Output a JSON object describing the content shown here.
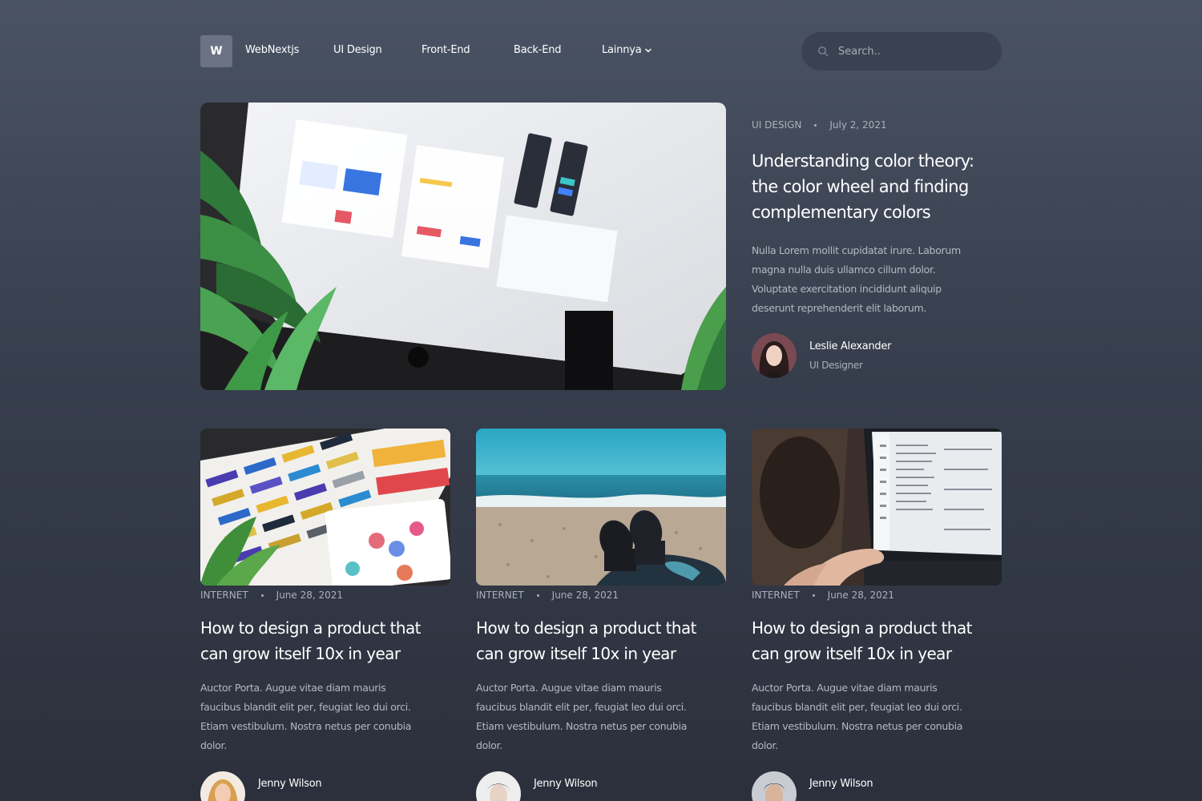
{
  "nav": {
    "logo_letter": "W",
    "logo_text": "WebNextjs",
    "links": [
      "UI Design",
      "Front-End",
      "Back-End",
      "Lainnya"
    ],
    "dropdown_icon": "chevron-down-icon"
  },
  "search": {
    "placeholder": "Search..",
    "icon": "search-icon"
  },
  "hero": {
    "category": "UI DESIGN",
    "date": "July 2, 2021",
    "title": "Understanding color theory: the color wheel and finding complementary colors",
    "description": "Nulla Lorem mollit cupidatat irure. Laborum magna nulla duis ullamco cillum dolor. Voluptate exercitation incididunt aliquip deserunt reprehenderit elit laborum.",
    "author": {
      "name": "Leslie Alexander",
      "role": "UI Designer"
    }
  },
  "cards": [
    {
      "category": "INTERNET",
      "date": "June 28, 2021",
      "title": "How to design a product that can grow itself 10x in year",
      "description": "Auctor Porta. Augue vitae diam mauris faucibus blandit elit per, feugiat leo dui orci. Etiam vestibulum. Nostra netus per conubia dolor.",
      "author": {
        "name": "Jenny Wilson"
      }
    },
    {
      "category": "INTERNET",
      "date": "June 28, 2021",
      "title": "How to design a product that can grow itself 10x in year",
      "description": "Auctor Porta. Augue vitae diam mauris faucibus blandit elit per, feugiat leo dui orci. Etiam vestibulum. Nostra netus per conubia dolor.",
      "author": {
        "name": "Jenny Wilson"
      }
    },
    {
      "category": "INTERNET",
      "date": "June 28, 2021",
      "title": "How to design a product that can grow itself 10x in year",
      "description": "Auctor Porta. Augue vitae diam mauris faucibus blandit elit per, feugiat leo dui orci. Etiam vestibulum. Nostra netus per conubia dolor.",
      "author": {
        "name": "Jenny Wilson"
      }
    }
  ],
  "colors": {
    "background_top": "#4a5364",
    "background_bottom": "#2b303c",
    "search_bg": "#3a4252",
    "logo_bg": "#6b7283",
    "muted_text": "#aab0bc"
  }
}
